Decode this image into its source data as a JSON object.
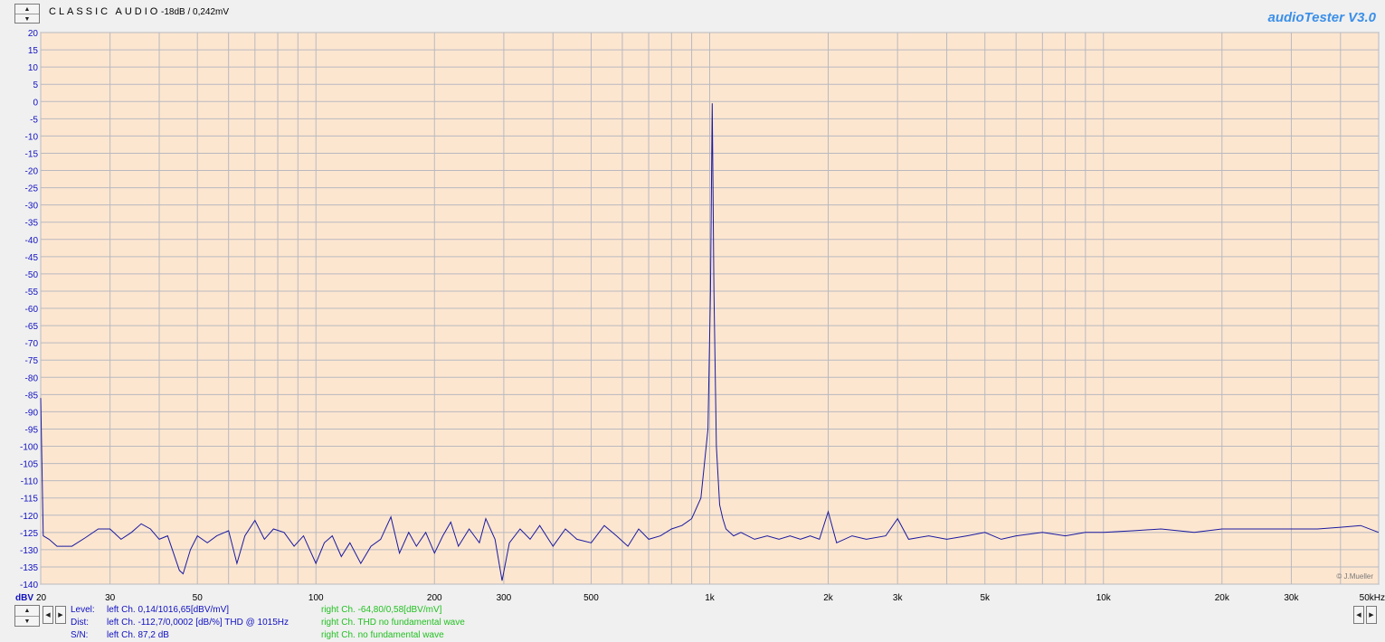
{
  "header": {
    "title": "CLASSIC AUDIO",
    "subtitle": "-18dB / 0,242mV",
    "brand": "audioTester  V3.0"
  },
  "watermark": "© J.Mueller",
  "colors": {
    "plot_bg": "#fde6d0",
    "grid": "#b9b9bf",
    "trace": "#1a1aa0",
    "axis_text": "#1010c0",
    "left_text": "#1010c0",
    "right_text": "#22c022",
    "brand": "#3b8fe8"
  },
  "chart_data": {
    "type": "line",
    "title": "",
    "xlabel": "",
    "ylabel": "dBV",
    "xscale": "log",
    "xlim": [
      20,
      50000
    ],
    "ylim": [
      -140,
      20
    ],
    "grid": true,
    "y_ticks": [
      20,
      15,
      10,
      5,
      0,
      -5,
      -10,
      -15,
      -20,
      -25,
      -30,
      -35,
      -40,
      -45,
      -50,
      -55,
      -60,
      -65,
      -70,
      -75,
      -80,
      -85,
      -90,
      -95,
      -100,
      -105,
      -110,
      -115,
      -120,
      -125,
      -130,
      -135,
      -140
    ],
    "x_ticks": [
      {
        "v": 20,
        "label": "20"
      },
      {
        "v": 30,
        "label": "30"
      },
      {
        "v": 50,
        "label": "50"
      },
      {
        "v": 100,
        "label": "100"
      },
      {
        "v": 200,
        "label": "200"
      },
      {
        "v": 300,
        "label": "300"
      },
      {
        "v": 500,
        "label": "500"
      },
      {
        "v": 1000,
        "label": "1k"
      },
      {
        "v": 2000,
        "label": "2k"
      },
      {
        "v": 3000,
        "label": "3k"
      },
      {
        "v": 5000,
        "label": "5k"
      },
      {
        "v": 10000,
        "label": "10k"
      },
      {
        "v": 20000,
        "label": "20k"
      },
      {
        "v": 30000,
        "label": "30k"
      },
      {
        "v": 50000,
        "label": "50kHz"
      }
    ],
    "series": [
      {
        "points": [
          [
            20,
            -86
          ],
          [
            20.3,
            -126
          ],
          [
            21,
            -127
          ],
          [
            22,
            -129
          ],
          [
            24,
            -129
          ],
          [
            26,
            -126.5
          ],
          [
            28,
            -124
          ],
          [
            30,
            -124
          ],
          [
            32,
            -127
          ],
          [
            34,
            -125
          ],
          [
            36,
            -122.5
          ],
          [
            38,
            -124
          ],
          [
            40,
            -127
          ],
          [
            42,
            -126
          ],
          [
            45,
            -136
          ],
          [
            46,
            -137
          ],
          [
            48,
            -130
          ],
          [
            50,
            -126
          ],
          [
            53,
            -128
          ],
          [
            56,
            -126
          ],
          [
            60,
            -124.5
          ],
          [
            63,
            -134
          ],
          [
            66,
            -126
          ],
          [
            70,
            -121.5
          ],
          [
            74,
            -127
          ],
          [
            78,
            -124
          ],
          [
            83,
            -125
          ],
          [
            88,
            -129
          ],
          [
            93,
            -126
          ],
          [
            100,
            -134
          ],
          [
            105,
            -128
          ],
          [
            110,
            -126
          ],
          [
            116,
            -132
          ],
          [
            122,
            -128
          ],
          [
            130,
            -134
          ],
          [
            138,
            -129
          ],
          [
            146,
            -127
          ],
          [
            155,
            -120.5
          ],
          [
            163,
            -131
          ],
          [
            172,
            -125
          ],
          [
            180,
            -129
          ],
          [
            190,
            -125
          ],
          [
            200,
            -131
          ],
          [
            210,
            -126
          ],
          [
            220,
            -122
          ],
          [
            230,
            -129
          ],
          [
            245,
            -124
          ],
          [
            260,
            -128
          ],
          [
            270,
            -121
          ],
          [
            285,
            -127
          ],
          [
            297,
            -139
          ],
          [
            310,
            -128
          ],
          [
            330,
            -124
          ],
          [
            350,
            -127
          ],
          [
            370,
            -123
          ],
          [
            400,
            -129
          ],
          [
            430,
            -124
          ],
          [
            460,
            -127
          ],
          [
            500,
            -128
          ],
          [
            540,
            -123
          ],
          [
            580,
            -126
          ],
          [
            620,
            -129
          ],
          [
            660,
            -124
          ],
          [
            700,
            -127
          ],
          [
            750,
            -126
          ],
          [
            800,
            -124
          ],
          [
            850,
            -123
          ],
          [
            900,
            -121
          ],
          [
            950,
            -115
          ],
          [
            990,
            -95
          ],
          [
            1005,
            -55
          ],
          [
            1015,
            -0.5
          ],
          [
            1025,
            -55
          ],
          [
            1040,
            -100
          ],
          [
            1060,
            -117
          ],
          [
            1080,
            -121
          ],
          [
            1100,
            -124
          ],
          [
            1150,
            -126
          ],
          [
            1200,
            -125
          ],
          [
            1300,
            -127
          ],
          [
            1400,
            -126
          ],
          [
            1500,
            -127
          ],
          [
            1600,
            -126
          ],
          [
            1700,
            -127
          ],
          [
            1800,
            -126
          ],
          [
            1900,
            -127
          ],
          [
            2000,
            -119
          ],
          [
            2100,
            -128
          ],
          [
            2300,
            -126
          ],
          [
            2500,
            -127
          ],
          [
            2800,
            -126
          ],
          [
            3000,
            -121
          ],
          [
            3200,
            -127
          ],
          [
            3600,
            -126
          ],
          [
            4000,
            -127
          ],
          [
            4500,
            -126
          ],
          [
            5000,
            -125
          ],
          [
            5500,
            -127
          ],
          [
            6000,
            -126
          ],
          [
            7000,
            -125
          ],
          [
            8000,
            -126
          ],
          [
            9000,
            -125
          ],
          [
            10000,
            -125
          ],
          [
            12000,
            -124.5
          ],
          [
            14000,
            -124
          ],
          [
            17000,
            -125
          ],
          [
            20000,
            -124
          ],
          [
            25000,
            -124
          ],
          [
            30000,
            -124
          ],
          [
            35000,
            -124
          ],
          [
            40000,
            -123.5
          ],
          [
            45000,
            -123
          ],
          [
            50000,
            -125
          ]
        ]
      }
    ]
  },
  "status": {
    "rows": [
      {
        "label": "Level:",
        "left": "left Ch. 0,14/1016,65[dBV/mV]",
        "right": "right Ch. -64,80/0,58[dBV/mV]"
      },
      {
        "label": "Dist:",
        "left": "left Ch. -112,7/0,0002 [dB/%] THD @ 1015Hz",
        "right": "right Ch. THD no fundamental wave"
      },
      {
        "label": "S/N:",
        "left": "left Ch. 87,2 dB",
        "right": "right Ch.  no fundamental wave"
      }
    ]
  }
}
